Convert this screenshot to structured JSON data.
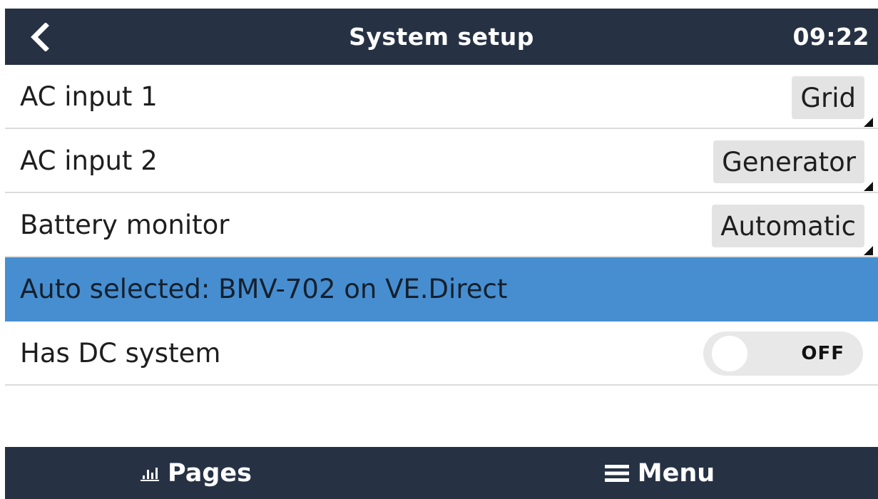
{
  "header": {
    "title": "System setup",
    "time": "09:22",
    "back_icon": "chevron-left-icon"
  },
  "settings": [
    {
      "label": "AC input 1",
      "value": "Grid"
    },
    {
      "label": "AC input 2",
      "value": "Generator"
    },
    {
      "label": "Battery monitor",
      "value": "Automatic"
    },
    {
      "label": "Auto selected: BMV-702 on VE.Direct"
    },
    {
      "label": "Has DC system",
      "toggle_state": "OFF"
    }
  ],
  "footer": {
    "pages_label": "Pages",
    "pages_icon": "bar-chart-icon",
    "menu_label": "Menu",
    "menu_icon": "hamburger-icon"
  },
  "colors": {
    "bar_background": "#263244",
    "selected_row": "#478ed0",
    "value_box": "#e3e3e3"
  }
}
